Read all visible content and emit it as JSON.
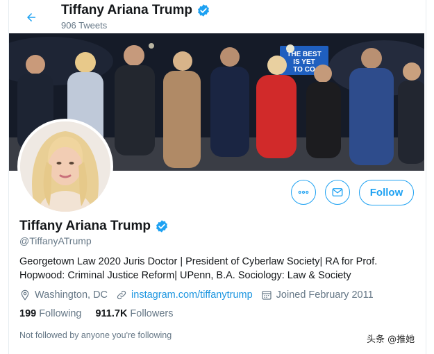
{
  "header": {
    "name": "Tiffany Ariana Trump",
    "tweet_count": "906 Tweets"
  },
  "banner": {
    "sign_text_line1": "THE BEST",
    "sign_text_line2": "IS YET",
    "sign_text_line3": "TO CO"
  },
  "profile": {
    "name": "Tiffany Ariana Trump",
    "handle": "@TiffanyATrump",
    "bio_line1": "Georgetown Law 2020 Juris Doctor | President of Cyberlaw Society| RA for Prof.",
    "bio_line2": "Hopwood: Criminal Justice Reform| UPenn, B.A. Sociology: Law & Society",
    "location": "Washington, DC",
    "website": "instagram.com/tiffanytrump",
    "joined": "Joined February 2011",
    "following_count": "199",
    "following_label": "Following",
    "followers_count": "911.7K",
    "followers_label": "Followers",
    "not_followed_text": "Not followed by anyone you're following"
  },
  "actions": {
    "follow_label": "Follow"
  },
  "watermark": "头条 @推她",
  "colors": {
    "accent": "#1da1f2",
    "secondary_text": "#657786"
  },
  "icons": [
    "back-arrow-icon",
    "verified-badge-icon",
    "more-icon",
    "message-icon",
    "location-icon",
    "link-icon",
    "calendar-icon"
  ]
}
